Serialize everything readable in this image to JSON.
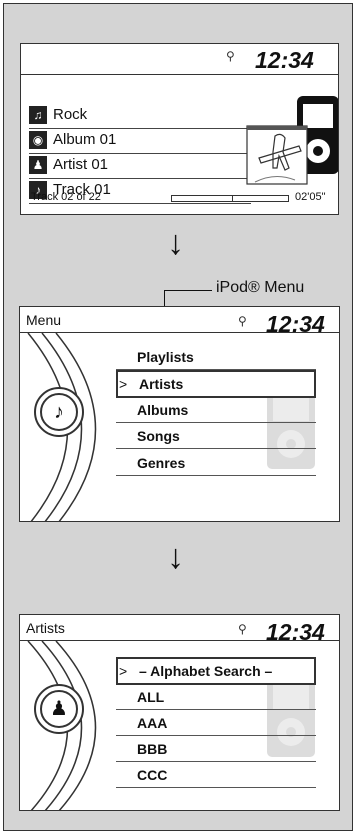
{
  "screen1": {
    "clock": "12:34",
    "rows": [
      {
        "icon": "guitar-icon",
        "glyph": "♫",
        "label": "Rock"
      },
      {
        "icon": "album-icon",
        "glyph": "◉",
        "label": "Album 01"
      },
      {
        "icon": "artist-icon",
        "glyph": "♟",
        "label": "Artist 01"
      },
      {
        "icon": "note-icon",
        "glyph": "♪",
        "label": "Track 01"
      }
    ],
    "track_position": "Track 02 of 22",
    "elapsed": "02'05\""
  },
  "callout": "iPod® Menu",
  "screen2": {
    "title": "Menu",
    "clock": "12:34",
    "items": [
      "Playlists",
      "Artists",
      "Albums",
      "Songs",
      "Genres"
    ]
  },
  "screen3": {
    "title": "Artists",
    "clock": "12:34",
    "items": [
      "– Alphabet Search –",
      "ALL",
      "AAA",
      "BBB",
      "CCC"
    ]
  }
}
